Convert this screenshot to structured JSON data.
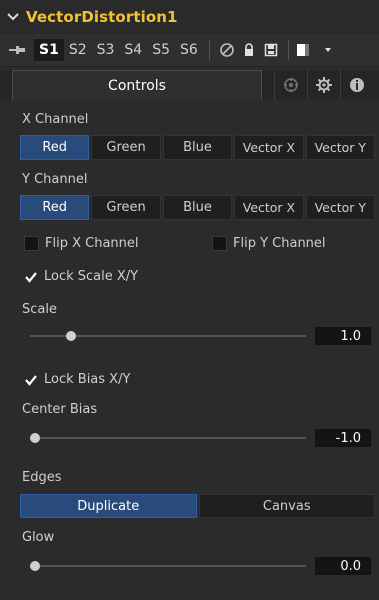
{
  "node": {
    "title": "VectorDistortion1"
  },
  "toolbar": {
    "slots": [
      "S1",
      "S2",
      "S3",
      "S4",
      "S5",
      "S6"
    ],
    "active_slot": "S1",
    "icons": [
      "pin-icon",
      "no-entry-icon",
      "lock-icon",
      "save-icon",
      "color-swatch-icon",
      "dropdown-caret-icon"
    ]
  },
  "tabs": {
    "controls_label": "Controls",
    "icons": [
      "tools-icon",
      "gear-icon",
      "info-icon"
    ]
  },
  "x_channel": {
    "label": "X Channel",
    "options": [
      "Red",
      "Green",
      "Blue",
      "Vector X",
      "Vector Y"
    ],
    "selected": "Red"
  },
  "y_channel": {
    "label": "Y Channel",
    "options": [
      "Red",
      "Green",
      "Blue",
      "Vector X",
      "Vector Y"
    ],
    "selected": "Red"
  },
  "checkboxes": {
    "flip_x": {
      "label": "Flip X Channel",
      "checked": false
    },
    "flip_y": {
      "label": "Flip Y Channel",
      "checked": false
    },
    "lock_scale": {
      "label": "Lock Scale X/Y",
      "checked": true
    },
    "lock_bias": {
      "label": "Lock Bias X/Y",
      "checked": true
    }
  },
  "scale": {
    "label": "Scale",
    "value": "1.0",
    "slider_fraction": 0.13
  },
  "center_bias": {
    "label": "Center Bias",
    "value": "-1.0",
    "slider_fraction": 0.0
  },
  "edges": {
    "label": "Edges",
    "options": [
      "Duplicate",
      "Canvas"
    ],
    "selected": "Duplicate"
  },
  "glow": {
    "label": "Glow",
    "value": "0.0",
    "slider_fraction": 0.0
  },
  "colors": {
    "accent_title": "#f1c232",
    "selected_button": "#294b7c"
  }
}
